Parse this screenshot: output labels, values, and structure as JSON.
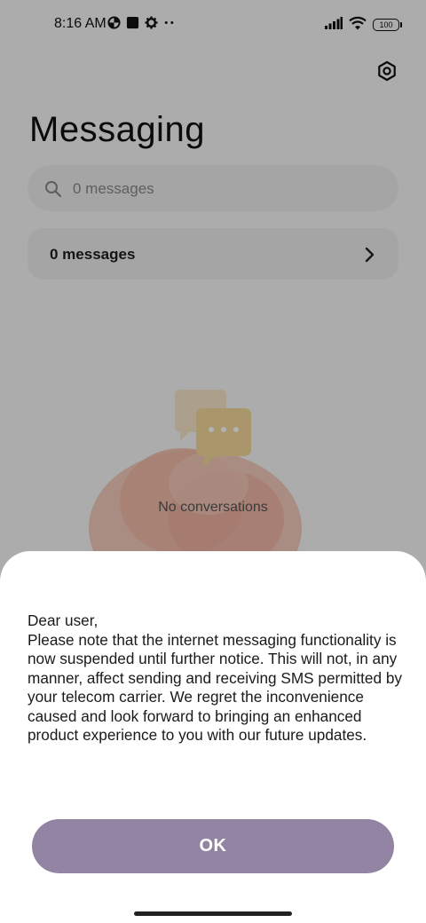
{
  "status_bar": {
    "time": "8:16 AM",
    "battery": "100",
    "left_icons": [
      "data-saver-icon",
      "square-notification-icon",
      "gear-icon",
      "more-dots-icon"
    ],
    "right_icons": [
      "signal-icon",
      "wifi-icon",
      "battery-icon"
    ]
  },
  "header": {
    "title": "Messaging",
    "settings_icon": "settings-hex-icon"
  },
  "search": {
    "placeholder": "0 messages",
    "icon": "search-icon"
  },
  "messages_row": {
    "label": "0 messages",
    "icon": "chevron-right-icon"
  },
  "empty_state": {
    "text": "No conversations",
    "illustration": "chat-bubbles-illustration"
  },
  "dialog": {
    "greeting": "Dear user,",
    "message": "Please note that the internet messaging functionality is now suspended until further notice. This will not, in any manner, affect sending and receiving SMS permitted by your telecom carrier. We regret the inconvenience caused and look forward to bringing an enhanced product experience to you with our future updates.",
    "ok_label": "OK"
  },
  "colors": {
    "ok_button": "#9484a4",
    "scrim": "rgba(0,0,0,0.30)"
  }
}
